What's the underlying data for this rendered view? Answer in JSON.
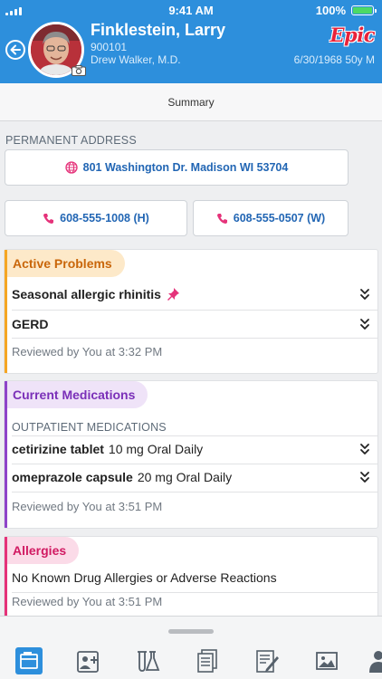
{
  "status_bar": {
    "time": "9:41 AM",
    "battery": "100%"
  },
  "patient": {
    "name": "Finklestein, Larry",
    "mrn": "900101",
    "provider": "Drew Walker, M.D.",
    "dob_age_sex": "6/30/1968 50y M"
  },
  "brand": {
    "logo_text": "Epic"
  },
  "tabs": {
    "active": "Summary"
  },
  "address": {
    "section_label": "PERMANENT ADDRESS",
    "value": "801 Washington Dr. Madison WI 53704"
  },
  "phones": {
    "home": "608-555-1008 (H)",
    "work": "608-555-0507 (W)"
  },
  "active_problems": {
    "title": "Active Problems",
    "items": [
      {
        "name": "Seasonal allergic rhinitis",
        "pinned": true
      },
      {
        "name": "GERD",
        "pinned": false
      }
    ],
    "reviewed": "Reviewed by You at 3:32 PM"
  },
  "medications": {
    "title": "Current Medications",
    "subhead": "OUTPATIENT MEDICATIONS",
    "items": [
      {
        "name": "cetirizine tablet",
        "sig": "10 mg Oral Daily"
      },
      {
        "name": "omeprazole capsule",
        "sig": "20 mg Oral Daily"
      }
    ],
    "reviewed": "Reviewed by You at 3:51 PM"
  },
  "allergies": {
    "title": "Allergies",
    "text": "No Known Drug Allergies or Adverse Reactions",
    "reviewed": "Reviewed by You at 3:51 PM"
  },
  "colors": {
    "header": "#2d8fdc",
    "link": "#2266b4",
    "problems_accent": "#f5a623",
    "medications_accent": "#8e44c9",
    "allergies_accent": "#e5337a"
  },
  "bottom_nav": [
    {
      "icon": "chart-review-icon"
    },
    {
      "icon": "patient-add-icon"
    },
    {
      "icon": "lab-results-icon"
    },
    {
      "icon": "documents-icon"
    },
    {
      "icon": "notes-icon"
    },
    {
      "icon": "media-icon"
    },
    {
      "icon": "care-team-icon"
    }
  ]
}
